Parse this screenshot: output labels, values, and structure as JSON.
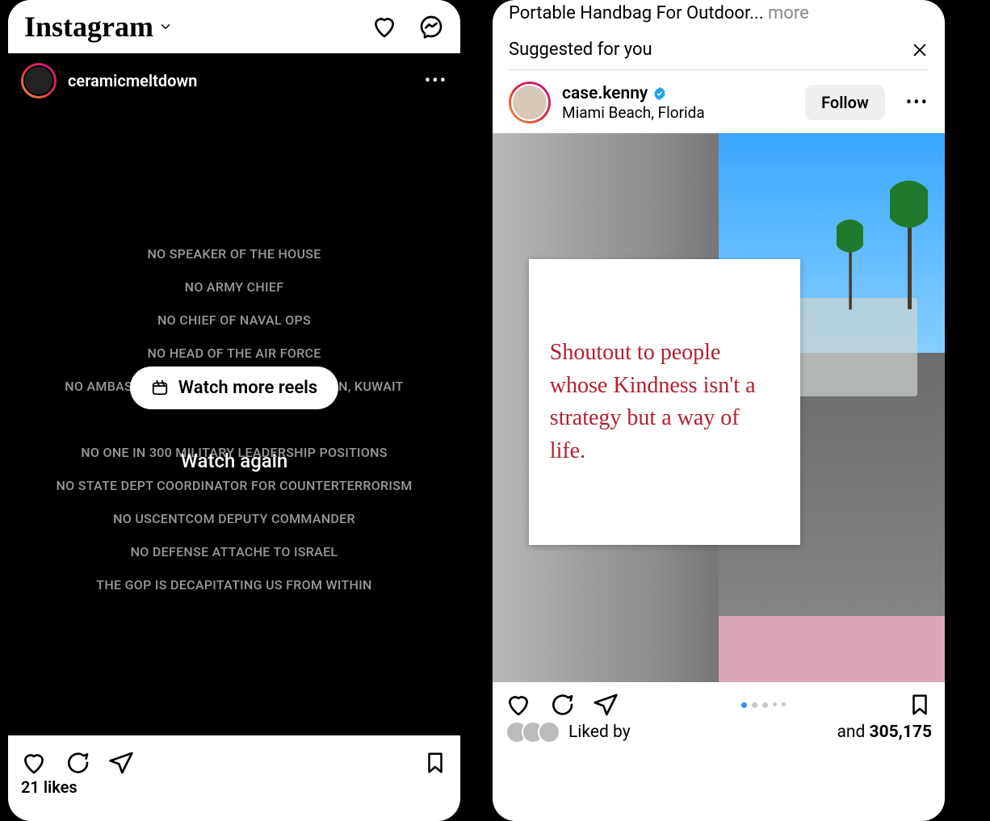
{
  "left": {
    "logo_text": "Instagram",
    "post": {
      "username": "ceramicmeltdown",
      "body_lines": [
        "NO SPEAKER OF THE HOUSE",
        "NO ARMY CHIEF",
        "NO CHIEF OF NAVAL OPS",
        "NO HEAD OF THE AIR FORCE",
        "NO AMBASSADOR TO EGYPT, ISRAEL, JORDAN, KUWAIT",
        "",
        "NO ONE IN 300 MILITARY LEADERSHIP POSITIONS",
        "NO STATE DEPT COORDINATOR FOR COUNTERTERRORISM",
        "NO USCENTCOM DEPUTY COMMANDER",
        "NO DEFENSE ATTACHE TO ISRAEL",
        "THE GOP IS DECAPITATING US FROM WITHIN"
      ],
      "watch_more": "Watch more reels",
      "watch_again": "Watch again",
      "likes_text": "21 likes"
    }
  },
  "right": {
    "ad_fragment": "Portable Handbag For Outdoor...",
    "more_label": "more",
    "suggested_heading": "Suggested for you",
    "post": {
      "username": "case.kenny",
      "verified": true,
      "location": "Miami Beach, Florida",
      "follow_label": "Follow",
      "note_text": "Shoutout to people whose Kindness isn't a strategy but a way of life.",
      "liked_by_prefix": "Liked by",
      "liked_and": "and",
      "liked_count": "305,175",
      "carousel_total": 5,
      "carousel_active": 1
    }
  }
}
